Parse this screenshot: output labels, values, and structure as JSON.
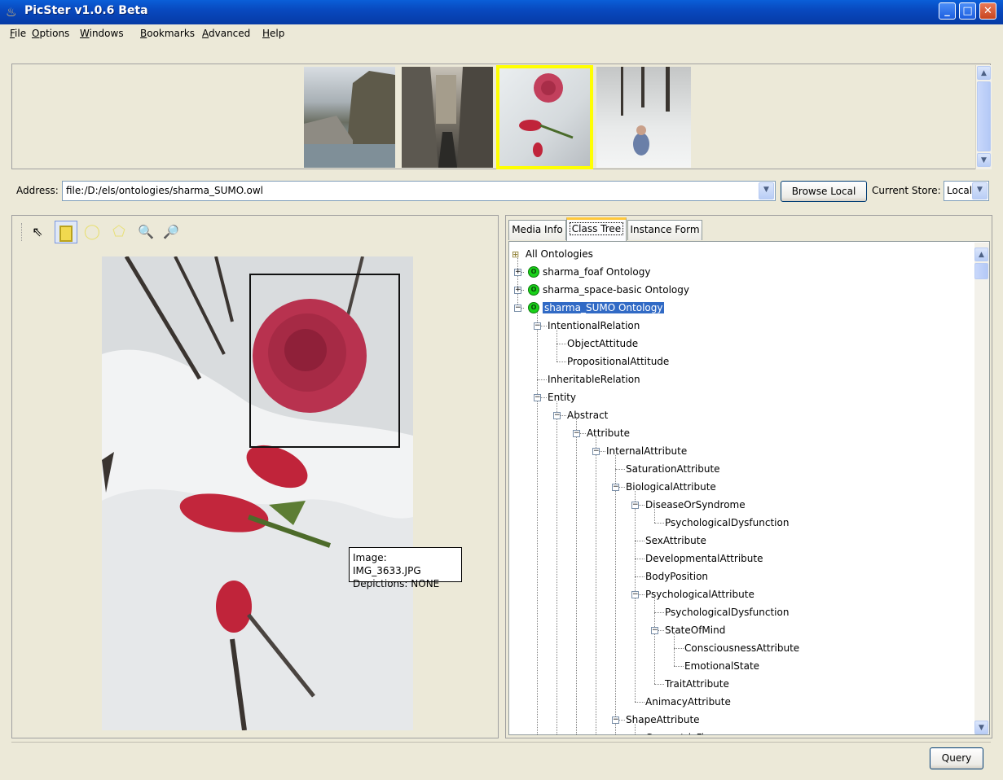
{
  "window": {
    "title": "PicSter v1.0.6 Beta"
  },
  "menu": [
    {
      "label": "File",
      "mnemonic": "F",
      "rest": "ile"
    },
    {
      "label": "Options",
      "mnemonic": "O",
      "rest": "ptions"
    },
    {
      "label": "Windows",
      "mnemonic": "W",
      "rest": "indows"
    },
    {
      "label": "Bookmarks",
      "mnemonic": "B",
      "rest": "ookmarks"
    },
    {
      "label": "Advanced",
      "mnemonic": "A",
      "rest": "dvanced"
    },
    {
      "label": "Help",
      "mnemonic": "H",
      "rest": "elp"
    }
  ],
  "thumbnails": [
    {
      "name": "mountain-town-river",
      "selected": false
    },
    {
      "name": "old-street",
      "selected": false
    },
    {
      "name": "rose-in-snow",
      "selected": true
    },
    {
      "name": "child-in-snow",
      "selected": false
    }
  ],
  "address": {
    "label": "Address:",
    "value": "file:/D:/els/ontologies/sharma_SUMO.owl",
    "browse_label": "Browse Local",
    "store_label": "Current Store:",
    "store_value": "Local"
  },
  "tools": [
    "pointer-icon",
    "rectangle-select-icon",
    "ellipse-select-icon",
    "polygon-select-icon",
    "zoom-in-icon",
    "zoom-out-icon"
  ],
  "tooltip": {
    "line1": "Image: IMG_3633.JPG",
    "line2": "Depictions: NONE"
  },
  "tabs": [
    {
      "label": "Media Info",
      "active": false
    },
    {
      "label": "Class Tree",
      "active": true
    },
    {
      "label": "Instance Form",
      "active": false
    }
  ],
  "tree": {
    "root": "All Ontologies",
    "nodes": [
      {
        "label": "sharma_foaf Ontology",
        "level": 0,
        "ontology": true,
        "expander": "+"
      },
      {
        "label": "sharma_space-basic Ontology",
        "level": 0,
        "ontology": true,
        "expander": "+"
      },
      {
        "label": "sharma_SUMO Ontology",
        "level": 0,
        "ontology": true,
        "expander": "-",
        "selected": true
      },
      {
        "label": "IntentionalRelation",
        "level": 1,
        "expander": "-"
      },
      {
        "label": "ObjectAttitude",
        "level": 2
      },
      {
        "label": "PropositionalAttitude",
        "level": 2
      },
      {
        "label": "InheritableRelation",
        "level": 1
      },
      {
        "label": "Entity",
        "level": 1,
        "expander": "-"
      },
      {
        "label": "Abstract",
        "level": 2,
        "expander": "-"
      },
      {
        "label": "Attribute",
        "level": 3,
        "expander": "-"
      },
      {
        "label": "InternalAttribute",
        "level": 4,
        "expander": "-"
      },
      {
        "label": "SaturationAttribute",
        "level": 5
      },
      {
        "label": "BiologicalAttribute",
        "level": 5,
        "expander": "-"
      },
      {
        "label": "DiseaseOrSyndrome",
        "level": 6,
        "expander": "-"
      },
      {
        "label": "PsychologicalDysfunction",
        "level": 7
      },
      {
        "label": "SexAttribute",
        "level": 6
      },
      {
        "label": "DevelopmentalAttribute",
        "level": 6
      },
      {
        "label": "BodyPosition",
        "level": 6
      },
      {
        "label": "PsychologicalAttribute",
        "level": 6,
        "expander": "-"
      },
      {
        "label": "PsychologicalDysfunction",
        "level": 7
      },
      {
        "label": "StateOfMind",
        "level": 7,
        "expander": "-"
      },
      {
        "label": "ConsciousnessAttribute",
        "level": 8
      },
      {
        "label": "EmotionalState",
        "level": 8
      },
      {
        "label": "TraitAttribute",
        "level": 7
      },
      {
        "label": "AnimacyAttribute",
        "level": 6
      },
      {
        "label": "ShapeAttribute",
        "level": 5,
        "expander": "-"
      },
      {
        "label": "GeometricFigure",
        "level": 6,
        "expander": "-"
      }
    ]
  },
  "query_label": "Query",
  "colors": {
    "titlebar": "#0849bf",
    "selection": "#316ac5",
    "thumb_selected_border": "#ffff00",
    "ontology_badge": "#19d119"
  }
}
